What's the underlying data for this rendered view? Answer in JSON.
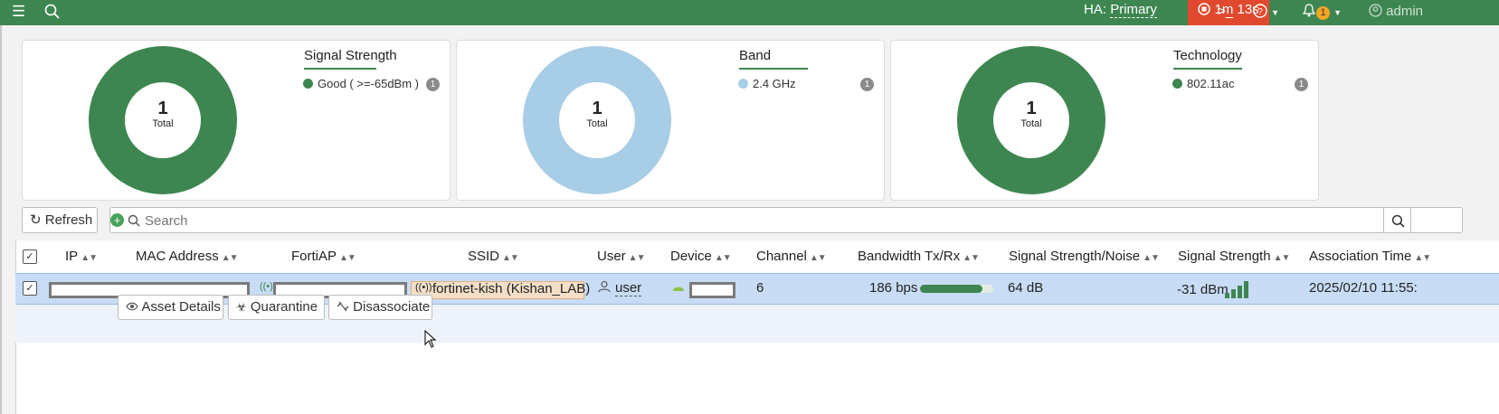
{
  "topbar": {
    "menu_icon": "hamburger-icon",
    "search_icon": "search-icon",
    "ha_label": "HA:",
    "ha_value": "Primary",
    "timer": "1m 13s",
    "cli_icon": "terminal-icon",
    "help_icon": "help-icon",
    "notification_count": "1",
    "user": "admin",
    "accent": "#3e8651",
    "timer_color": "#e0492d"
  },
  "cards": [
    {
      "title": "Signal Strength",
      "total": "1",
      "total_label": "Total",
      "legend": "Good ( >=-65dBm )",
      "count": "1",
      "color": "#3e8651"
    },
    {
      "title": "Band",
      "total": "1",
      "total_label": "Total",
      "legend": "2.4 GHz",
      "count": "1",
      "color": "#a8cde6"
    },
    {
      "title": "Technology",
      "total": "1",
      "total_label": "Total",
      "legend": "802.11ac",
      "count": "1",
      "color": "#3e8651"
    }
  ],
  "toolbar": {
    "refresh_label": "Refresh",
    "search_placeholder": "Search"
  },
  "table": {
    "columns": [
      "IP",
      "MAC Address",
      "FortiAP",
      "SSID",
      "User",
      "Device",
      "Channel",
      "Bandwidth Tx/Rx",
      "Signal Strength/Noise",
      "Signal Strength",
      "Association Time"
    ],
    "row": {
      "ssid": "fortinet-kish (Kishan_LAB)",
      "user": "user",
      "channel": "6",
      "bandwidth": "186 bps",
      "bandwidth_fraction": 0.85,
      "snr": "64 dB",
      "signal": "-31 dBm",
      "assoc_time": "2025/02/10 11:55:"
    },
    "actions": [
      "Asset Details",
      "Quarantine",
      "Disassociate"
    ]
  }
}
